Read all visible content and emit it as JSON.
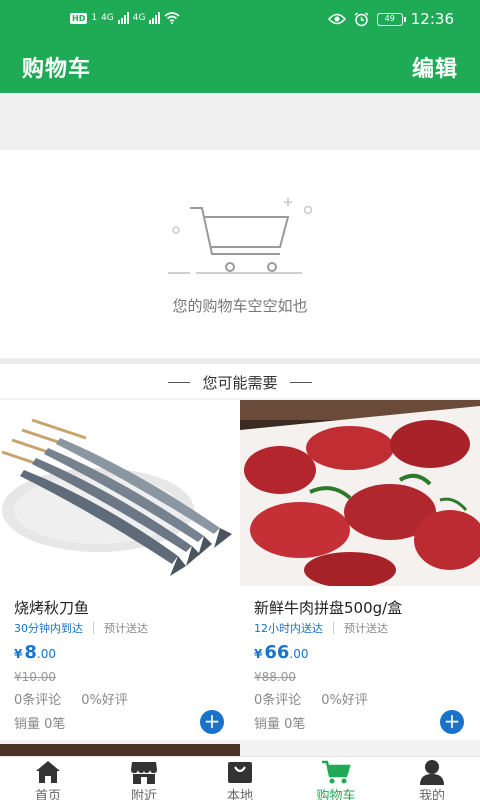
{
  "status_bar": {
    "hd": "HD",
    "sim": "1",
    "net1": "4G",
    "net2": "4G",
    "battery": "49",
    "time": "12:36"
  },
  "header": {
    "title": "购物车",
    "edit_label": "编辑"
  },
  "empty_cart": {
    "message": "您的购物车空空如也"
  },
  "recommend": {
    "title": "您可能需要",
    "products": [
      {
        "name": "烧烤秋刀鱼",
        "ship_time": "30分钟内到达",
        "ship_note": "预计送达",
        "currency": "¥",
        "price_int": "8",
        "price_dec": ".00",
        "old_price": "¥10.00",
        "reviews": "0条评论",
        "good_rate": "0%好评",
        "sales": "销量 0笔"
      },
      {
        "name": "新鲜牛肉拼盘500g/盒",
        "ship_time": "12小时内送达",
        "ship_note": "预计送达",
        "currency": "¥",
        "price_int": "66",
        "price_dec": ".00",
        "old_price": "¥88.00",
        "reviews": "0条评论",
        "good_rate": "0%好评",
        "sales": "销量 0笔"
      }
    ]
  },
  "tabbar": {
    "items": [
      {
        "label": "首页",
        "icon": "home-icon"
      },
      {
        "label": "附近",
        "icon": "store-icon"
      },
      {
        "label": "本地",
        "icon": "bag-icon"
      },
      {
        "label": "购物车",
        "icon": "cart-icon"
      },
      {
        "label": "我的",
        "icon": "user-icon"
      }
    ],
    "active_index": 3
  },
  "colors": {
    "brand": "#1faa55",
    "price": "#1a72c9"
  }
}
